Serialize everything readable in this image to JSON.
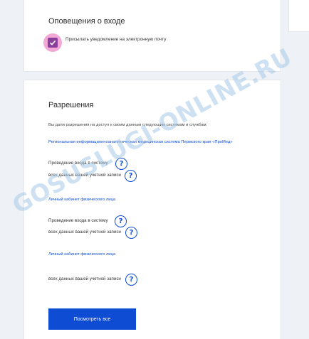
{
  "notifications": {
    "title": "Оповещения о входе",
    "checkbox_label": "Присылать уведомление на электронную почту",
    "checked": true
  },
  "permissions": {
    "title": "Разрешения",
    "intro": "Вы дали разрешения на доступ к своим данным следующим системам и службам:",
    "systems": [
      {
        "name": "Региональная информационноаналитическая медицинская система Пермского края «ПроМед»",
        "items": [
          "Проведение входа в систему",
          "всех данных вашей учетной записи"
        ]
      },
      {
        "name": "Личный кабинет физического лица",
        "items": [
          "Проведение входа в систему",
          "всех данных вашей учетной записи"
        ]
      },
      {
        "name": "Личный кабинет физического лица",
        "items": [
          "всех данных вашей учетной записи"
        ]
      }
    ],
    "view_all_button": "Посмотреть все"
  },
  "watermark": "GOSUSLUGI-ONLINE.RU",
  "colors": {
    "accent": "#0d4cd3",
    "checkbox": "#8a3f9a",
    "checkbox_focus": "#f3a9d6",
    "background": "#eef1f5"
  }
}
